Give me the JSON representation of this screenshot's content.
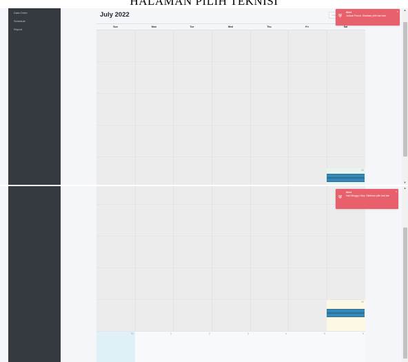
{
  "page_heading": "HALAMAN PILIH TEKNISI",
  "sidebar": {
    "items": [
      {
        "label": "Data Order"
      },
      {
        "label": "Schedule"
      },
      {
        "label": "Report"
      }
    ]
  },
  "calendar": {
    "title": "July 2022",
    "today_button": "today",
    "days_of_week": [
      "Sun",
      "Mon",
      "Tue",
      "Wed",
      "Thu",
      "Fri",
      "Sat"
    ],
    "top_highlight_day": "30",
    "bottom_highlight_day": "30",
    "last_week_days": [
      "31",
      "1",
      "2",
      "3",
      "4",
      "5",
      "6"
    ],
    "colors": {
      "event": "#3788b7",
      "today_cell": "#fcf8e3",
      "selected_cell": "#e8f4f0",
      "blue_cell": "#dff0f7"
    }
  },
  "alerts": [
    {
      "title": "Alert",
      "message": "Jadwal Penuh, Silahkan pilih hari lain",
      "icon": "shield-alert-icon",
      "color": "#e8606b"
    },
    {
      "title": "Alert",
      "message": "Hari Minggu Libur, Silahkan pilih hari lain",
      "icon": "shield-alert-icon",
      "color": "#e8606b"
    }
  ]
}
